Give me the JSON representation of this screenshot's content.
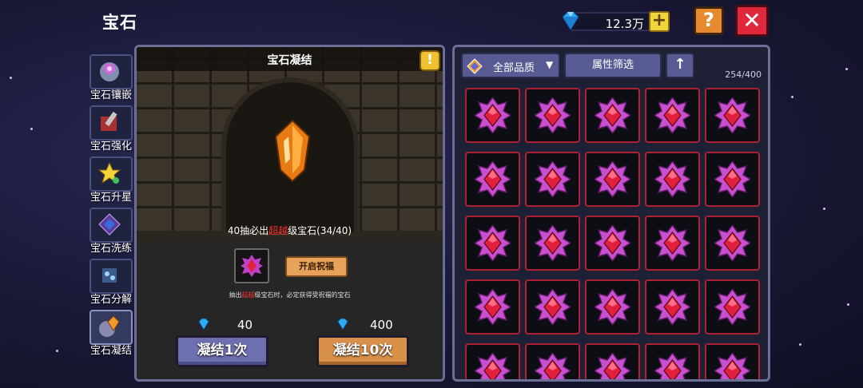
{
  "header": {
    "title": "宝石",
    "currency": {
      "icon": "diamond-icon",
      "amount": "12.3万",
      "add_label": "+"
    },
    "help_label": "?",
    "close_label": "✕"
  },
  "sidebar": {
    "items": [
      {
        "label": "宝石镶嵌",
        "icon": "gem-inlay-icon",
        "active": false
      },
      {
        "label": "宝石强化",
        "icon": "gem-enhance-icon",
        "active": false
      },
      {
        "label": "宝石升星",
        "icon": "star-upgrade-icon",
        "active": false
      },
      {
        "label": "宝石洗练",
        "icon": "gem-refine-icon",
        "active": false
      },
      {
        "label": "宝石分解",
        "icon": "gem-decompose-icon",
        "active": false
      },
      {
        "label": "宝石凝结",
        "icon": "gem-condense-icon",
        "active": true
      }
    ]
  },
  "left_panel": {
    "title": "宝石凝结",
    "info_label": "!",
    "pity": {
      "prefix": "40抽必出",
      "highlight": "超越",
      "suffix": "级宝石(34/40)"
    },
    "bless_button": "开启祝福",
    "note": {
      "prefix": "抽出",
      "highlight": "超越",
      "suffix": "级宝石时，必定获得受祝福的宝石"
    },
    "single": {
      "cost": "40",
      "button": "凝结1次"
    },
    "ten": {
      "cost": "400",
      "button": "凝结10次"
    }
  },
  "right_panel": {
    "quality_filter": "全部品质",
    "attribute_filter": "属性筛选",
    "sort_label": "↑",
    "count": "254/400",
    "grid": {
      "columns": 5,
      "visible_rows": 5,
      "item_icon": "red-gem-icon",
      "border_color": "#b02035"
    }
  },
  "colors": {
    "accent_orange": "#d9904a",
    "accent_purple": "#6d6fb0",
    "close_red": "#e0283c",
    "highlight_red": "#ff3030"
  }
}
